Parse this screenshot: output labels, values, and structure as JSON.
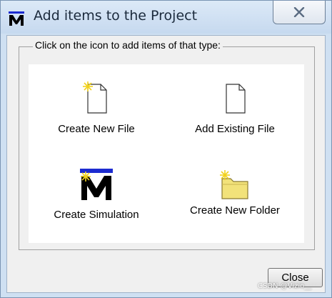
{
  "window": {
    "title": "Add items to the Project",
    "app_icon": "m-logo-icon",
    "close_icon": "close-x-icon"
  },
  "group": {
    "legend": "Click on the icon to add items of that type:"
  },
  "items": [
    {
      "label": "Create New File",
      "icon": "new-file-icon"
    },
    {
      "label": "Add Existing File",
      "icon": "file-icon"
    },
    {
      "label": "Create Simulation",
      "icon": "simulation-m-icon"
    },
    {
      "label": "Create New Folder",
      "icon": "new-folder-icon"
    }
  ],
  "buttons": {
    "close": "Close"
  },
  "watermark": "CSDN @Vizio__",
  "colors": {
    "title_bar": "#c6d9ef",
    "dialog_bg": "#f0f0f0",
    "panel_bg": "#ffffff",
    "accent_blue": "#1c2bd0",
    "sparkle": "#f2d21c",
    "folder": "#f2e27a"
  }
}
